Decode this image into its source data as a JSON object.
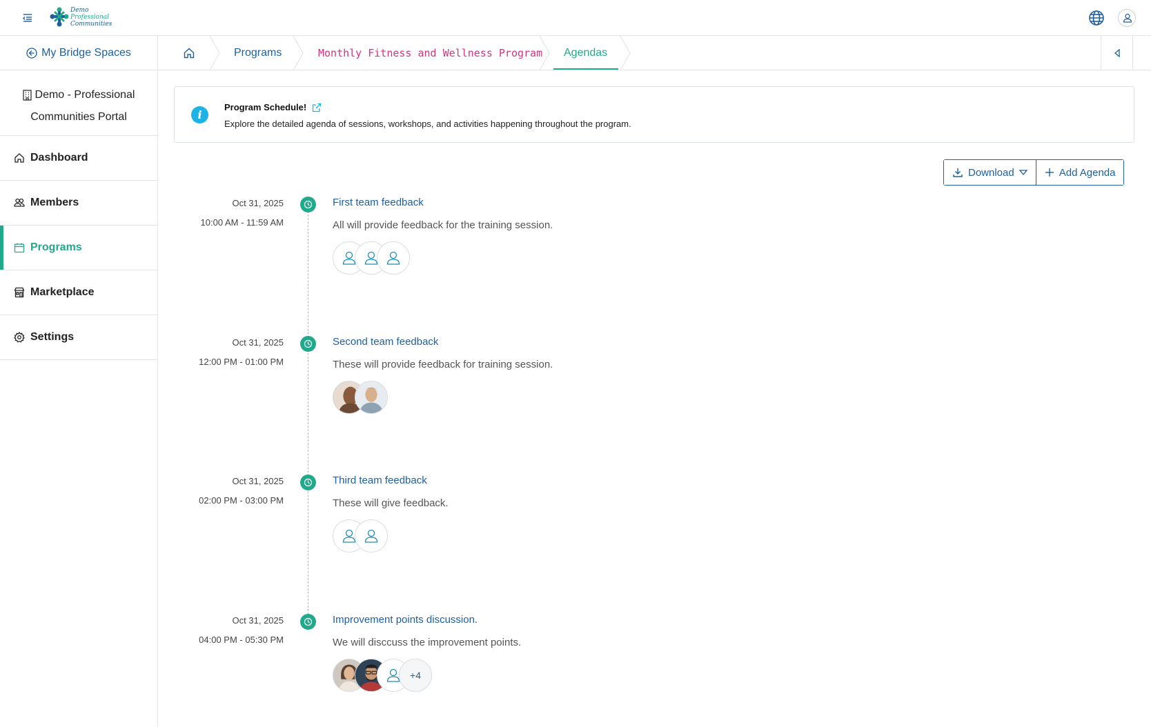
{
  "header": {
    "logo_text": [
      "Demo",
      "Professional",
      "Communities"
    ],
    "menu_icon": "menu-collapse-icon",
    "globe_icon": "globe-icon",
    "user_icon": "user-icon"
  },
  "sidebar": {
    "back_label": "My Bridge Spaces",
    "org_line1": "Demo - Professional",
    "org_line2": "Communities Portal",
    "items": [
      {
        "label": "Dashboard",
        "icon": "home-icon",
        "active": false
      },
      {
        "label": "Members",
        "icon": "users-icon",
        "active": false
      },
      {
        "label": "Programs",
        "icon": "calendar-icon",
        "active": true
      },
      {
        "label": "Marketplace",
        "icon": "store-icon",
        "active": false
      },
      {
        "label": "Settings",
        "icon": "gear-icon",
        "active": false
      }
    ]
  },
  "breadcrumb": {
    "home_icon": "home-icon",
    "items": [
      "Programs",
      "Monthly Fitness and Wellness Program",
      "Agendas"
    ]
  },
  "banner": {
    "title": "Program Schedule!",
    "text": "Explore the detailed agenda of sessions, workshops, and activities happening throughout the program."
  },
  "actions": {
    "download_label": "Download",
    "add_label": "Add Agenda"
  },
  "agendas": [
    {
      "date": "Oct 31, 2025",
      "time": "10:00 AM - 11:59 AM",
      "title": "First team feedback",
      "description": "All will provide feedback for the training session.",
      "avatars": [
        "placeholder",
        "placeholder",
        "placeholder"
      ]
    },
    {
      "date": "Oct 31, 2025",
      "time": "12:00 PM - 01:00 PM",
      "title": "Second team feedback",
      "description": "These will provide feedback for training session.",
      "avatars": [
        "photo",
        "photo"
      ]
    },
    {
      "date": "Oct 31, 2025",
      "time": "02:00 PM - 03:00 PM",
      "title": "Third team feedback",
      "description": "These will give feedback.",
      "avatars": [
        "placeholder",
        "placeholder"
      ]
    },
    {
      "date": "Oct 31, 2025",
      "time": "04:00 PM - 05:30 PM",
      "title": "Improvement points discussion.",
      "description": "We will disccuss the improvement points.",
      "avatars": [
        "photo",
        "photo",
        "placeholder"
      ],
      "more": "+4"
    }
  ],
  "colors": {
    "accent": "#21a98c",
    "link": "#1d5f9f",
    "program_crumb": "#d63384",
    "info": "#1eb3e5"
  }
}
